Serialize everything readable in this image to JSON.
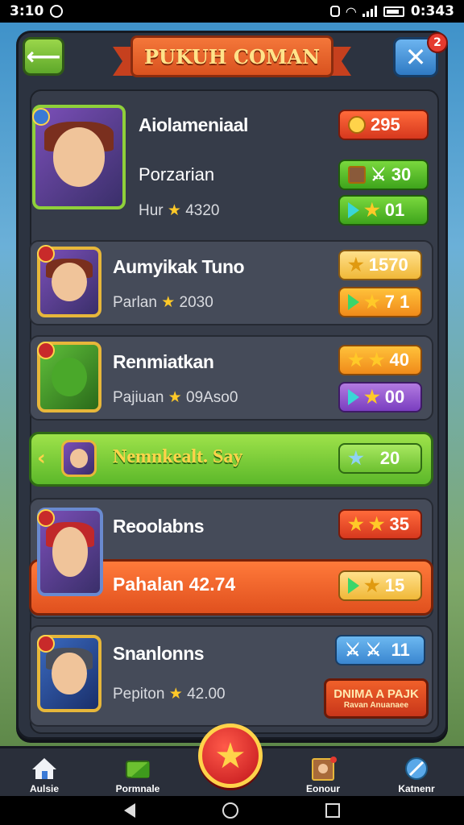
{
  "status_bar": {
    "time": "3:10",
    "clock_right": "0:343"
  },
  "header": {
    "title": "PUKUH COMAN",
    "close_badge": "2"
  },
  "players": [
    {
      "name": "Aiolameniaal",
      "role": "Porzarian",
      "sub_label": "Hur",
      "score": "4320",
      "pills": [
        "295",
        "30",
        "01"
      ]
    },
    {
      "name": "Aumyikak Tuno",
      "role": "Parlan",
      "score": "2030",
      "pills": [
        "1570",
        "7 1"
      ]
    },
    {
      "name": "Renmiatkan",
      "role": "Pajiuan",
      "score": "09Aso0",
      "pills": [
        "40",
        "00"
      ]
    },
    {
      "name": "Reoolabns",
      "role": "Pahalan",
      "score": "42.74",
      "pills": [
        "35",
        "15"
      ]
    },
    {
      "name": "Snanlonns",
      "role": "Pepiton",
      "score": "42.00",
      "pills": [
        "11"
      ]
    }
  ],
  "highlight": {
    "label": "Nemnkealt. Say",
    "value": "20"
  },
  "pack_button": {
    "line1": "DNIMA A PAJK",
    "line2": "Ravan Anuanaee"
  },
  "bottom_nav": {
    "item1": "Aulsie",
    "item2": "Pormnale",
    "item3": "Eonour",
    "item4": "Katnenr"
  },
  "colors": {
    "accent_orange": "#e0501e",
    "accent_green": "#5cb82a",
    "panel": "#2c3340"
  }
}
